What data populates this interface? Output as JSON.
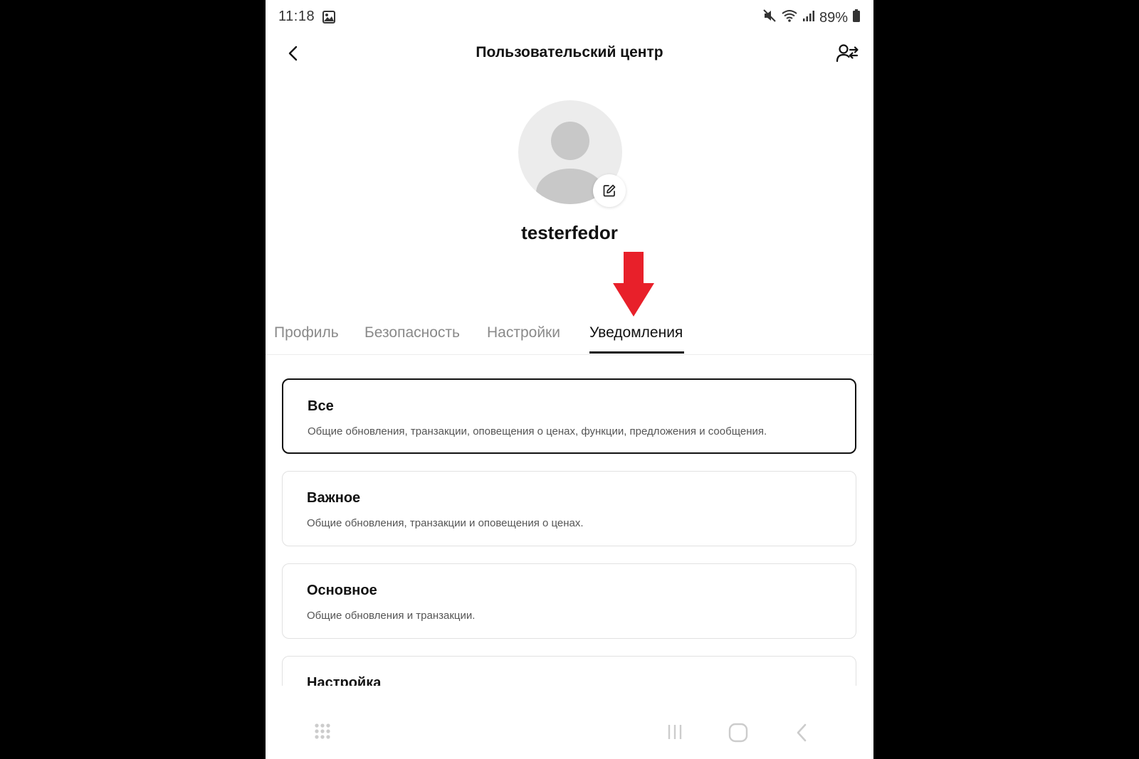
{
  "status_bar": {
    "time": "11:18",
    "battery": "89%",
    "icons": [
      "image-icon",
      "mute-icon",
      "wifi-icon",
      "signal-icon",
      "battery-icon"
    ]
  },
  "header": {
    "title": "Пользовательский центр",
    "back_icon": "chevron-left-icon",
    "action_icon": "switch-account-icon"
  },
  "profile": {
    "username": "testerfedor",
    "avatar_icon": "default-avatar-icon",
    "edit_icon": "edit-icon"
  },
  "tabs": [
    {
      "label": "Профиль",
      "active": false
    },
    {
      "label": "Безопасность",
      "active": false
    },
    {
      "label": "Настройки",
      "active": false
    },
    {
      "label": "Уведомления",
      "active": true
    }
  ],
  "notification_options": [
    {
      "title": "Все",
      "description": "Общие обновления, транзакции, оповещения о ценах, функции, предложения и сообщения.",
      "selected": true
    },
    {
      "title": "Важное",
      "description": "Общие обновления, транзакции и оповещения о ценах.",
      "selected": false
    },
    {
      "title": "Основное",
      "description": "Общие обновления и транзакции.",
      "selected": false
    },
    {
      "title": "Настройка",
      "description": "",
      "selected": false
    }
  ],
  "annotation": {
    "arrow_color": "#e8202a"
  },
  "nav_bar": {
    "icons": [
      "apps-grid-icon",
      "recents-icon",
      "home-icon",
      "back-icon"
    ]
  },
  "colors": {
    "accent": "#111111",
    "muted_text": "#8a8a8a",
    "card_border": "#e1e1e1"
  }
}
